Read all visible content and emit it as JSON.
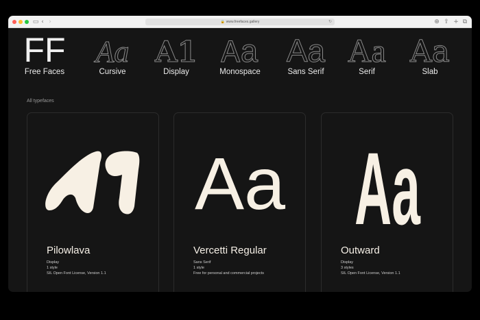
{
  "browser": {
    "url": "www.freefaces.gallery",
    "traffic_lights": [
      "#ff5f57",
      "#febc2e",
      "#28c840"
    ],
    "icons": [
      "sidebar-icon",
      "back-icon",
      "forward-icon",
      "lock-icon",
      "reload-icon",
      "download-icon",
      "share-icon",
      "new-tab-icon",
      "tabs-icon"
    ]
  },
  "categories": [
    {
      "glyph": "FF",
      "label": "Free Faces"
    },
    {
      "glyph": "Aa",
      "label": "Cursive"
    },
    {
      "glyph": "A1",
      "label": "Display"
    },
    {
      "glyph": "Aa",
      "label": "Monospace"
    },
    {
      "glyph": "Aa",
      "label": "Sans Serif"
    },
    {
      "glyph": "Aa",
      "label": "Serif"
    },
    {
      "glyph": "Aa",
      "label": "Slab"
    }
  ],
  "section_label": "All typefaces",
  "cards": [
    {
      "specimen": "A1",
      "name": "Pilowlava",
      "category": "Display",
      "styles": "1 style",
      "license": "SIL Open Font License, Version 1.1"
    },
    {
      "specimen": "Aa",
      "name": "Vercetti Regular",
      "category": "Sans Serif",
      "styles": "1 style",
      "license": "Free for personal and commercial projects"
    },
    {
      "specimen": "Aa",
      "name": "Outward",
      "category": "Display",
      "styles": "3 styles",
      "license": "SIL Open Font License, Version 1.1"
    }
  ],
  "colors": {
    "background": "#151515",
    "specimen": "#f7f0e4",
    "text": "#ececec",
    "muted": "#9a9a9a",
    "outline": "#8a8a8a"
  }
}
